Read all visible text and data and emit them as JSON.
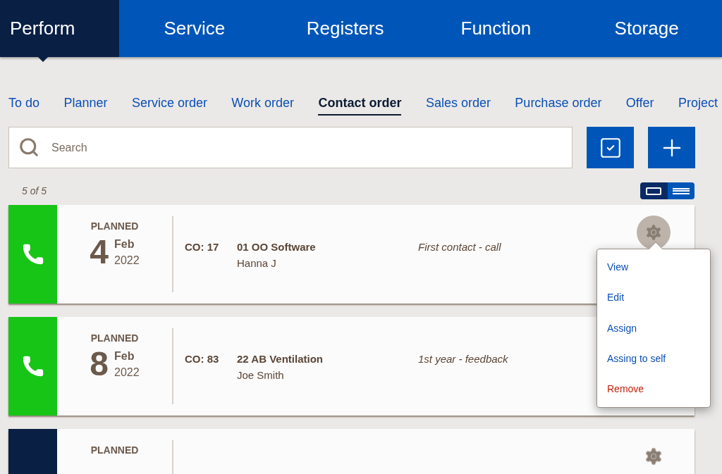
{
  "main_nav": [
    {
      "label": "Perform",
      "selected": true
    },
    {
      "label": "Service",
      "selected": false
    },
    {
      "label": "Registers",
      "selected": false
    },
    {
      "label": "Function",
      "selected": false
    },
    {
      "label": "Storage",
      "selected": false
    }
  ],
  "sub_tabs": [
    {
      "label": "To do",
      "selected": false
    },
    {
      "label": "Planner",
      "selected": false
    },
    {
      "label": "Service order",
      "selected": false
    },
    {
      "label": "Work order",
      "selected": false
    },
    {
      "label": "Contact order",
      "selected": true
    },
    {
      "label": "Sales order",
      "selected": false
    },
    {
      "label": "Purchase order",
      "selected": false
    },
    {
      "label": "Offer",
      "selected": false
    },
    {
      "label": "Project",
      "selected": false
    }
  ],
  "search": {
    "placeholder": "Search"
  },
  "count": "5 of 5",
  "view_toggle": [
    {
      "kind": "card",
      "selected": true
    },
    {
      "kind": "list",
      "selected": false
    }
  ],
  "orders": [
    {
      "kind": "call",
      "color": "#17c517",
      "status": "PLANNED",
      "day": "4",
      "month": "Feb",
      "year": "2022",
      "number": "CO: 17",
      "customer": "01 OO Software",
      "person": "Hanna J",
      "subject": "First contact - call",
      "menu_open": true
    },
    {
      "kind": "call",
      "color": "#17c517",
      "status": "PLANNED",
      "day": "8",
      "month": "Feb",
      "year": "2022",
      "number": "CO: 83",
      "customer": "22 AB Ventilation",
      "person": "Joe Smith",
      "subject": "1st year - feedback",
      "menu_open": false
    },
    {
      "kind": "other",
      "color": "#0a1f44",
      "status": "PLANNED",
      "menu_open": false
    }
  ],
  "menu": [
    {
      "label": "View",
      "kind": "normal"
    },
    {
      "label": "Edit",
      "kind": "normal"
    },
    {
      "label": "Assign",
      "kind": "normal"
    },
    {
      "label": "Assing to self",
      "kind": "normal"
    },
    {
      "label": "Remove",
      "kind": "danger"
    }
  ]
}
